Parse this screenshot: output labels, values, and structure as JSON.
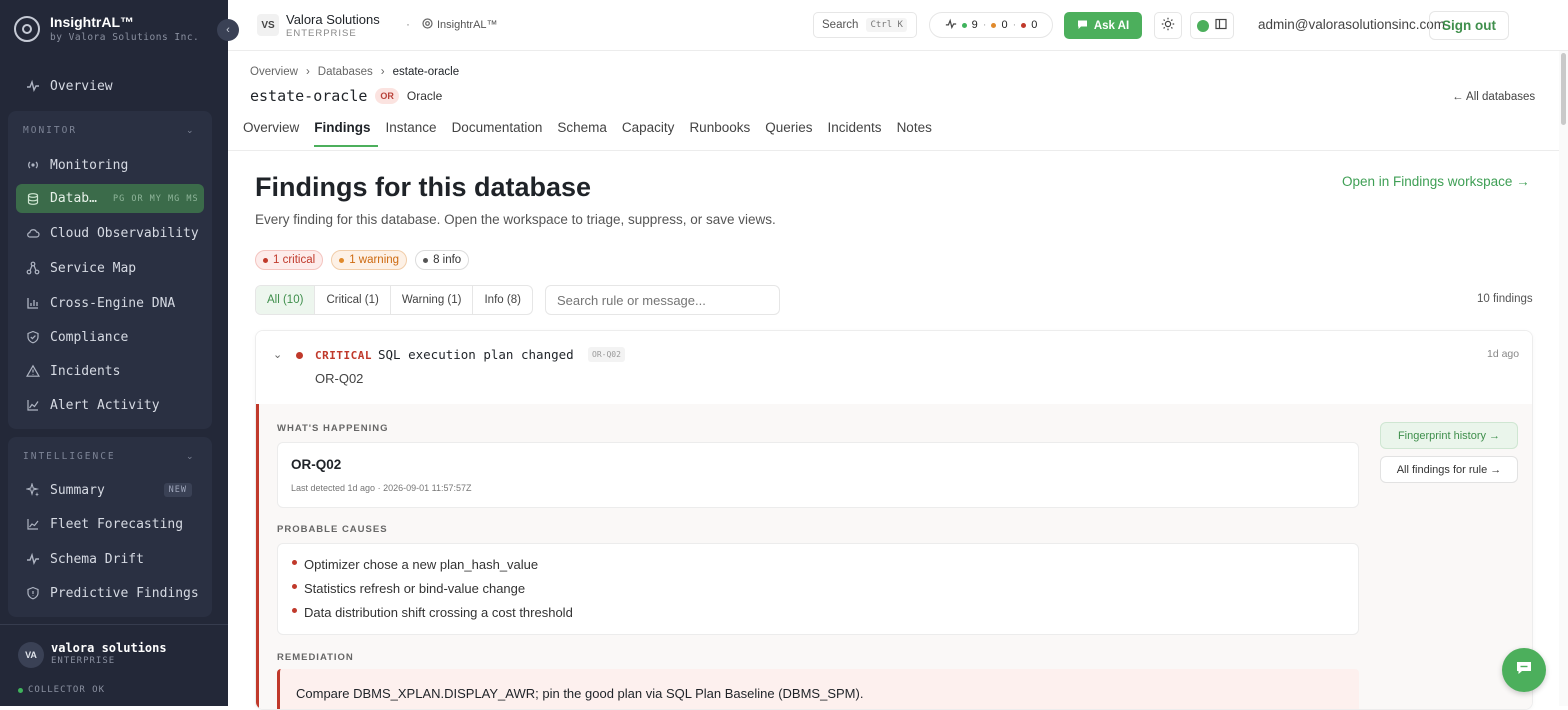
{
  "brand": {
    "name": "InsightrAL™",
    "sub": "by Valora Solutions Inc."
  },
  "sidebar": {
    "overview": "Overview",
    "monitor_title": "MONITOR",
    "monitor_items": [
      {
        "label": "Monitoring",
        "icon": "broadcast-icon"
      },
      {
        "label": "Datab…",
        "icon": "database-icon",
        "tags": "PG OR MY MG MS"
      },
      {
        "label": "Cloud Observability",
        "icon": "cloud-icon"
      },
      {
        "label": "Service Map",
        "icon": "network-icon"
      },
      {
        "label": "Cross-Engine DNA",
        "icon": "bar-chart-icon"
      },
      {
        "label": "Compliance",
        "icon": "shield-icon"
      },
      {
        "label": "Incidents",
        "icon": "alert-triangle-icon"
      },
      {
        "label": "Alert Activity",
        "icon": "line-chart-icon"
      }
    ],
    "intel_title": "INTELLIGENCE",
    "intel_items": [
      {
        "label": "Summary",
        "icon": "sparkle-icon",
        "badge": "NEW"
      },
      {
        "label": "Fleet Forecasting",
        "icon": "trend-icon"
      },
      {
        "label": "Schema Drift",
        "icon": "pulse-icon"
      },
      {
        "label": "Predictive Findings",
        "icon": "shield-icon"
      }
    ],
    "user": {
      "initials": "VA",
      "name": "valora solutions",
      "plan": "ENTERPRISE",
      "collector": "COLLECTOR OK"
    }
  },
  "header": {
    "org_initials": "VS",
    "org_name": "Valora Solutions",
    "org_plan": "ENTERPRISE",
    "product": "InsightrAL™",
    "search_label": "Search",
    "search_kbd": "Ctrl K",
    "status": {
      "ok": "9",
      "warn": "0",
      "crit": "0"
    },
    "ask_ai": "Ask AI",
    "email": "admin@valorasolutionsinc.com",
    "signout": "Sign out"
  },
  "db": {
    "breadcrumb": [
      "Overview",
      "Databases",
      "estate-oracle"
    ],
    "name": "estate-oracle",
    "engine_badge": "OR",
    "engine_name": "Oracle",
    "all_link": "← All databases",
    "tabs": [
      "Overview",
      "Findings",
      "Instance",
      "Documentation",
      "Schema",
      "Capacity",
      "Runbooks",
      "Queries",
      "Incidents",
      "Notes"
    ]
  },
  "findings": {
    "title": "Findings for this database",
    "workspace_link": "Open in Findings workspace →",
    "subtitle": "Every finding for this database. Open the workspace to triage, suppress, or save views.",
    "chips": {
      "critical": "1 critical",
      "warning": "1 warning",
      "info": "8 info"
    },
    "filters": [
      "All (10)",
      "Critical (1)",
      "Warning (1)",
      "Info (8)"
    ],
    "search_placeholder": "Search rule or message...",
    "count": "10 findings",
    "card": {
      "severity": "CRITICAL",
      "title": "SQL execution plan changed",
      "code": "OR-Q02",
      "target": "OR-Q02",
      "age": "1d ago",
      "whats_happening_label": "WHAT'S HAPPENING",
      "what_title": "OR-Q02",
      "what_meta": "Last detected 1d ago · 2026-09-01 11:57:57Z",
      "causes_label": "PROBABLE CAUSES",
      "causes": [
        "Optimizer chose a new plan_hash_value",
        "Statistics refresh or bind-value change",
        "Data distribution shift crossing a cost threshold"
      ],
      "remediation_label": "REMEDIATION",
      "remediation": "Compare DBMS_XPLAN.DISPLAY_AWR; pin the good plan via SQL Plan Baseline (DBMS_SPM).",
      "fingerprint_btn": "Fingerprint history →",
      "rule_btn": "All findings for rule →"
    }
  },
  "colors": {
    "accent": "#4caf5c",
    "critical": "#c0392b",
    "warning": "#cd6a10",
    "sidebar": "#232838"
  }
}
